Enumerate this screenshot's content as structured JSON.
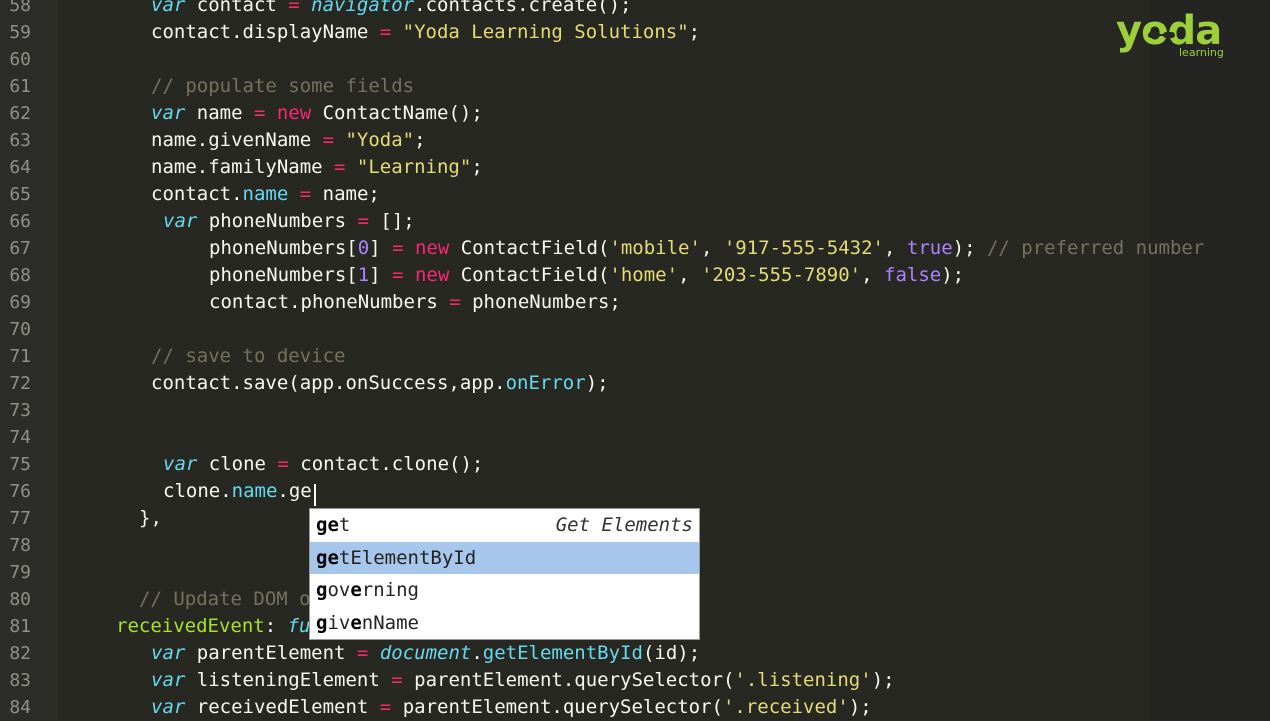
{
  "logo": {
    "text": "yoda",
    "subtext": "learning",
    "color": "#9ccf3a"
  },
  "theme": {
    "background": "#272822",
    "keyword": "#66d9ef",
    "operator": "#f92672",
    "string": "#e6db74",
    "number": "#ae81ff",
    "comment": "#75715e",
    "function": "#a6e22e"
  },
  "lines": [
    {
      "n": "58",
      "t": [
        [
          "kw",
          "var "
        ],
        [
          "plain",
          "contact "
        ],
        [
          "op",
          "= "
        ],
        [
          "glob",
          "navigator"
        ],
        [
          "plain",
          ".contacts.create();"
        ]
      ]
    },
    {
      "n": "59",
      "t": [
        [
          "plain",
          "contact.displayName "
        ],
        [
          "op",
          "= "
        ],
        [
          "str",
          "\"Yoda Learning Solutions\""
        ],
        [
          "plain",
          ";"
        ]
      ]
    },
    {
      "n": "60",
      "t": []
    },
    {
      "n": "61",
      "t": [
        [
          "cm",
          "// populate some fields"
        ]
      ]
    },
    {
      "n": "62",
      "t": [
        [
          "kw",
          "var "
        ],
        [
          "plain",
          "name "
        ],
        [
          "op",
          "= new "
        ],
        [
          "plain",
          "ContactName();"
        ]
      ]
    },
    {
      "n": "63",
      "t": [
        [
          "plain",
          "name.givenName "
        ],
        [
          "op",
          "= "
        ],
        [
          "str",
          "\"Yoda\""
        ],
        [
          "plain",
          ";"
        ]
      ]
    },
    {
      "n": "64",
      "t": [
        [
          "plain",
          "name.familyName "
        ],
        [
          "op",
          "= "
        ],
        [
          "str",
          "\"Learning\""
        ],
        [
          "plain",
          ";"
        ]
      ]
    },
    {
      "n": "65",
      "t": [
        [
          "plain",
          "contact."
        ],
        [
          "prop",
          "name"
        ],
        [
          "plain",
          " "
        ],
        [
          "op",
          "= "
        ],
        [
          "plain",
          "name;"
        ]
      ]
    },
    {
      "n": "66",
      "t": [
        [
          "kw",
          "var "
        ],
        [
          "plain",
          "phoneNumbers "
        ],
        [
          "op",
          "= "
        ],
        [
          "plain",
          "[];"
        ]
      ]
    },
    {
      "n": "67",
      "t": [
        [
          "plain",
          "phoneNumbers["
        ],
        [
          "num",
          "0"
        ],
        [
          "plain",
          "] "
        ],
        [
          "op",
          "= new "
        ],
        [
          "plain",
          "ContactField("
        ],
        [
          "str",
          "'mobile'"
        ],
        [
          "plain",
          ", "
        ],
        [
          "str",
          "'917-555-5432'"
        ],
        [
          "plain",
          ", "
        ],
        [
          "num",
          "true"
        ],
        [
          "plain",
          "); "
        ],
        [
          "cm",
          "// preferred number"
        ]
      ]
    },
    {
      "n": "68",
      "t": [
        [
          "plain",
          "phoneNumbers["
        ],
        [
          "num",
          "1"
        ],
        [
          "plain",
          "] "
        ],
        [
          "op",
          "= new "
        ],
        [
          "plain",
          "ContactField("
        ],
        [
          "str",
          "'home'"
        ],
        [
          "plain",
          ", "
        ],
        [
          "str",
          "'203-555-7890'"
        ],
        [
          "plain",
          ", "
        ],
        [
          "num",
          "false"
        ],
        [
          "plain",
          ");"
        ]
      ]
    },
    {
      "n": "69",
      "t": [
        [
          "plain",
          "contact.phoneNumbers "
        ],
        [
          "op",
          "= "
        ],
        [
          "plain",
          "phoneNumbers;"
        ]
      ]
    },
    {
      "n": "70",
      "t": []
    },
    {
      "n": "71",
      "t": [
        [
          "cm",
          "// save to device"
        ]
      ]
    },
    {
      "n": "72",
      "t": [
        [
          "plain",
          "contact.save(app.onSuccess,app."
        ],
        [
          "prop",
          "onError"
        ],
        [
          "plain",
          ");"
        ]
      ]
    },
    {
      "n": "73",
      "t": []
    },
    {
      "n": "74",
      "t": []
    },
    {
      "n": "75",
      "t": [
        [
          "kw",
          "var "
        ],
        [
          "plain",
          "clone "
        ],
        [
          "op",
          "= "
        ],
        [
          "plain",
          "contact.clone();"
        ]
      ]
    },
    {
      "n": "76",
      "t": [
        [
          "plain",
          "clone."
        ],
        [
          "prop",
          "name"
        ],
        [
          "plain",
          ".ge"
        ]
      ]
    },
    {
      "n": "77",
      "t": [
        [
          "plain",
          "},"
        ]
      ]
    },
    {
      "n": "78",
      "t": []
    },
    {
      "n": "79",
      "t": []
    },
    {
      "n": "80",
      "t": [
        [
          "cm",
          "// Update DOM o"
        ]
      ]
    },
    {
      "n": "81",
      "t": [
        [
          "fn",
          "receivedEvent"
        ],
        [
          "plain",
          ": "
        ],
        [
          "kw",
          "fu"
        ]
      ]
    },
    {
      "n": "82",
      "t": [
        [
          "kw",
          "var "
        ],
        [
          "plain",
          "parentElement "
        ],
        [
          "op",
          "= "
        ],
        [
          "glob",
          "document"
        ],
        [
          "plain",
          "."
        ],
        [
          "prop",
          "getElementById"
        ],
        [
          "plain",
          "(id);"
        ]
      ]
    },
    {
      "n": "83",
      "t": [
        [
          "kw",
          "var "
        ],
        [
          "plain",
          "listeningElement "
        ],
        [
          "op",
          "= "
        ],
        [
          "plain",
          "parentElement.querySelector("
        ],
        [
          "str",
          "'.listening'"
        ],
        [
          "plain",
          ");"
        ]
      ]
    },
    {
      "n": "84",
      "t": [
        [
          "kw",
          "var "
        ],
        [
          "plain",
          "receivedElement "
        ],
        [
          "op",
          "= "
        ],
        [
          "plain",
          "parentElement.querySelector("
        ],
        [
          "str",
          "'.received'"
        ],
        [
          "plain",
          ");"
        ]
      ]
    }
  ],
  "autocomplete": {
    "items": [
      {
        "match": "ge",
        "rest": "t",
        "hint": "Get Elements"
      },
      {
        "match": "ge",
        "rest": "tElementById",
        "hint": ""
      },
      {
        "match": "g",
        "mid": "ov",
        "match2": "e",
        "rest": "rning",
        "hint": ""
      },
      {
        "match": "g",
        "mid": "iv",
        "match2": "e",
        "rest": "nName",
        "hint": ""
      }
    ]
  }
}
